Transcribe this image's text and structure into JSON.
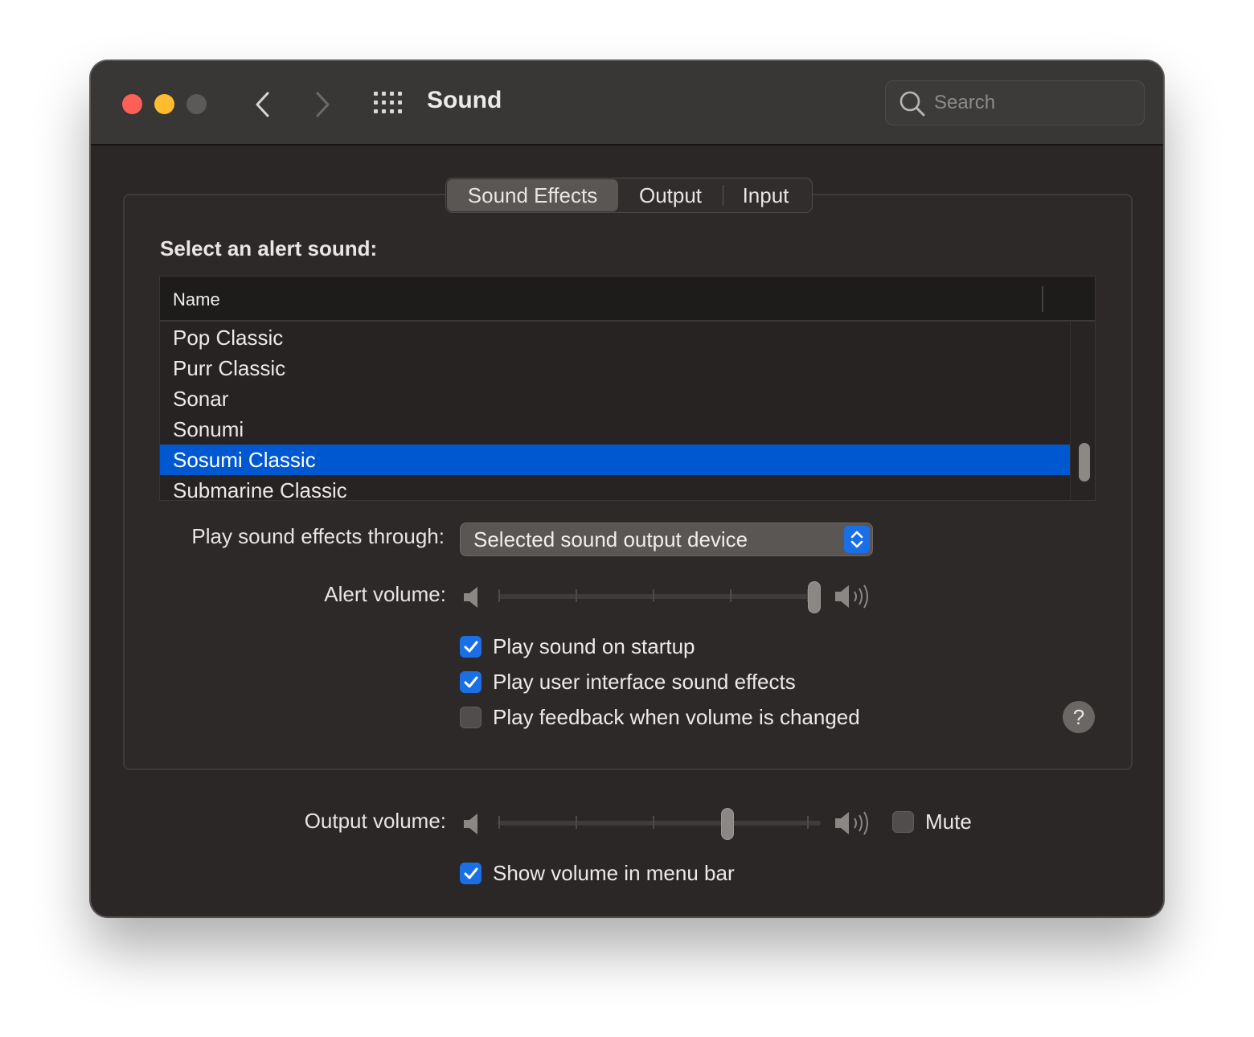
{
  "window": {
    "title": "Sound"
  },
  "toolbar": {
    "search_placeholder": "Search",
    "back_icon": "chevron-left",
    "forward_icon": "chevron-right",
    "grid_icon": "show-all-grid"
  },
  "tabs": [
    {
      "label": "Sound Effects",
      "active": true
    },
    {
      "label": "Output",
      "active": false
    },
    {
      "label": "Input",
      "active": false
    }
  ],
  "alert_sound": {
    "label": "Select an alert sound:",
    "column_header": "Name",
    "items": [
      {
        "name": "Pop Classic",
        "selected": false
      },
      {
        "name": "Purr Classic",
        "selected": false
      },
      {
        "name": "Sonar",
        "selected": false
      },
      {
        "name": "Sonumi",
        "selected": false
      },
      {
        "name": "Sosumi Classic",
        "selected": true
      },
      {
        "name": "Submarine Classic",
        "selected": false
      }
    ]
  },
  "play_through": {
    "label": "Play sound effects through:",
    "value": "Selected sound output device"
  },
  "alert_volume": {
    "label": "Alert volume:",
    "level": 1.0
  },
  "checkboxes": [
    {
      "label": "Play sound on startup",
      "checked": true
    },
    {
      "label": "Play user interface sound effects",
      "checked": true
    },
    {
      "label": "Play feedback when volume is changed",
      "checked": false
    }
  ],
  "help": {
    "label": "?"
  },
  "output_volume": {
    "label": "Output volume:",
    "level": 0.72
  },
  "mute": {
    "label": "Mute",
    "checked": false
  },
  "show_volume": {
    "label": "Show volume in menu bar",
    "checked": true
  },
  "colors": {
    "selection": "#0058d0",
    "accent": "#1a6fe6",
    "close": "#fe5f57",
    "minimize": "#febc2e"
  }
}
